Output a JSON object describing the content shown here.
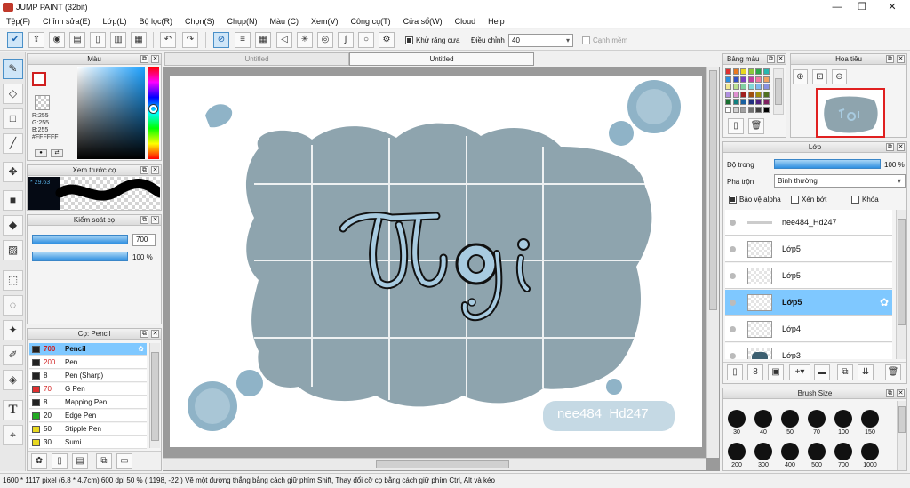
{
  "window": {
    "title": "JUMP PAINT (32bit)",
    "minimize": "—",
    "maximize": "❐",
    "close": "✕"
  },
  "menu": [
    "Tệp(F)",
    "Chỉnh sửa(E)",
    "Lớp(L)",
    "Bộ lọc(R)",
    "Chọn(S)",
    "Chụp(N)",
    "Màu (C)",
    "Xem(V)",
    "Công cụ(T)",
    "Cửa sổ(W)",
    "Cloud",
    "Help"
  ],
  "toolbar": {
    "antialias_label": "Khử răng cưa",
    "adjust_label": "Điều chỉnh",
    "adjust_value": "40",
    "sharp_label": "Cạnh mềm"
  },
  "tabs": [
    "Untitled",
    "Untitled"
  ],
  "color_panel": {
    "title": "Màu",
    "r": "R:255",
    "g": "G:255",
    "b": "B:255",
    "hex": "#FFFFFF"
  },
  "brush_preview": {
    "title": "Xem trước cọ",
    "size": "29.63"
  },
  "brush_control": {
    "title": "Kiểm soát cọ",
    "size_value": "700",
    "opacity_value": "100 %",
    "size_fraction": 1.0,
    "opacity_fraction": 1.0
  },
  "brush_list": {
    "title": "Cọ: Pencil",
    "items": [
      {
        "size": "700",
        "name": "Pencil",
        "color": "#222222",
        "selected": true
      },
      {
        "size": "200",
        "name": "Pen",
        "color": "#222222",
        "selected": false
      },
      {
        "size": "8",
        "name": "Pen (Sharp)",
        "color": "#222222",
        "selected": false
      },
      {
        "size": "70",
        "name": "G Pen",
        "color": "#e03030",
        "selected": false
      },
      {
        "size": "8",
        "name": "Mapping Pen",
        "color": "#222222",
        "selected": false
      },
      {
        "size": "20",
        "name": "Edge Pen",
        "color": "#22aa22",
        "selected": false
      },
      {
        "size": "50",
        "name": "Stipple Pen",
        "color": "#e8d820",
        "selected": false
      },
      {
        "size": "30",
        "name": "Sumi",
        "color": "#e8d820",
        "selected": false
      }
    ]
  },
  "canvas": {
    "watermark": "nee484_Hd247"
  },
  "palette": {
    "title": "Bảng màu",
    "colors": [
      "#e03030",
      "#e87820",
      "#e8d820",
      "#8cc83c",
      "#2ca84a",
      "#26b8b0",
      "#2a8fe0",
      "#3050c8",
      "#7a40c0",
      "#c040a0",
      "#f07aa0",
      "#f0a060",
      "#f0e890",
      "#b8e090",
      "#80d0a0",
      "#80d8d8",
      "#80b8f0",
      "#8890e0",
      "#b090e0",
      "#e090d0",
      "#a02020",
      "#a05010",
      "#a09010",
      "#507020",
      "#187030",
      "#108080",
      "#1860a0",
      "#203080",
      "#502080",
      "#802060",
      "#ffffff",
      "#d0d0d0",
      "#a0a0a0",
      "#707070",
      "#404040",
      "#000000"
    ]
  },
  "navigator": {
    "title": "Hoa tiêu"
  },
  "layers": {
    "title": "Lớp",
    "opacity_label": "Độ trong",
    "opacity_value": "100 %",
    "opacity_fraction": 1.0,
    "blend_label": "Pha trộn",
    "blend_value": "Bình thường",
    "protect_alpha": "Bảo vệ alpha",
    "clip": "Xén bớt",
    "lock": "Khóa",
    "items": [
      {
        "name": "nee484_Hd247",
        "selected": false
      },
      {
        "name": "Lớp5",
        "selected": false
      },
      {
        "name": "Lớp5",
        "selected": false
      },
      {
        "name": "Lớp5",
        "selected": true
      },
      {
        "name": "Lớp4",
        "selected": false
      },
      {
        "name": "Lớp3",
        "selected": false
      }
    ]
  },
  "brush_size": {
    "title": "Brush Size",
    "row1": [
      "30",
      "40",
      "50",
      "70",
      "100",
      "150"
    ],
    "row2": [
      "200",
      "300",
      "400",
      "500",
      "700",
      "1000"
    ]
  },
  "status": {
    "dims": "1600 * 1117 pixel",
    "physical": "(6.8 * 4.7cm)",
    "dpi": "600 dpi",
    "zoom": "50 %",
    "coords": "( 1198, -22 )",
    "hint": "Vẽ một đường thẳng bằng cách giữ phím Shift, Thay đổi cỡ cọ bằng cách giữ phím Ctrl, Alt và kéo"
  }
}
